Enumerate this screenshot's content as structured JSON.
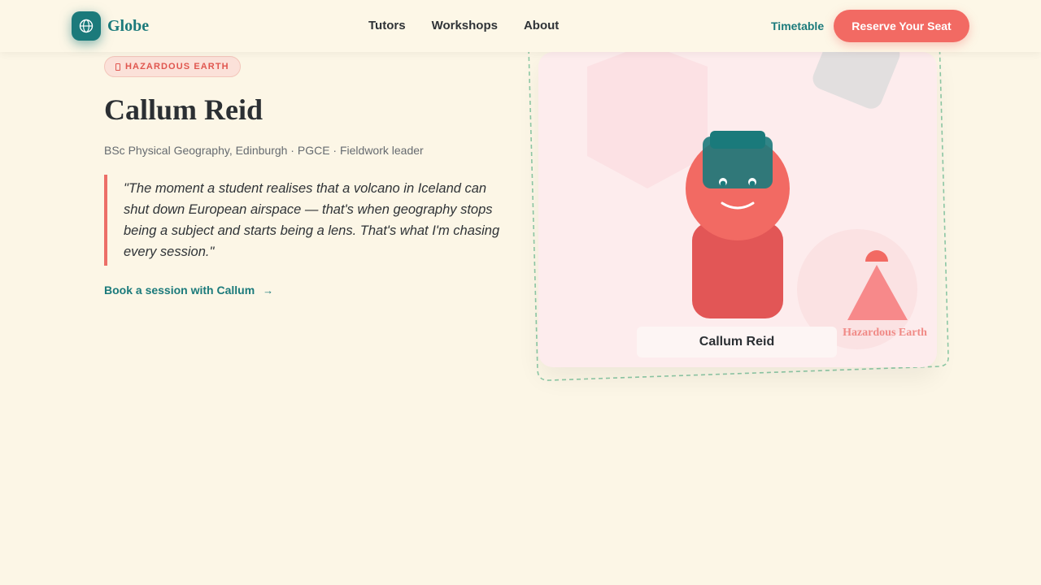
{
  "header": {
    "logo_text": "Globe",
    "logo_icon": "globe-icon",
    "nav": [
      {
        "label": "Tutors"
      },
      {
        "label": "Workshops"
      },
      {
        "label": "About"
      }
    ],
    "timetable_label": "Timetable",
    "cta_label": "Reserve Your Seat"
  },
  "profile": {
    "tag": "HAZARDOUS EARTH",
    "tag_icon": "volcano-icon",
    "name": "Callum Reid",
    "credentials": "BSc Physical Geography, Edinburgh · PGCE · Fieldwork leader",
    "quote": "\"The moment a student realises that a volcano in Iceland can shut down European airspace — that's when geography stops being a subject and starts being a lens. That's what I'm chasing every session.\"",
    "book_label": "Book a session with Callum",
    "book_arrow": "→"
  },
  "card": {
    "caption": "Callum Reid",
    "badge_label": "Hazardous Earth",
    "illustration": "tutor-avatar-illustration",
    "badge_icon": "volcano-icon"
  },
  "colors": {
    "background": "#fcf6e6",
    "teal": "#1b7a7b",
    "coral": "#f26a63",
    "card_pink": "#fdeced"
  }
}
